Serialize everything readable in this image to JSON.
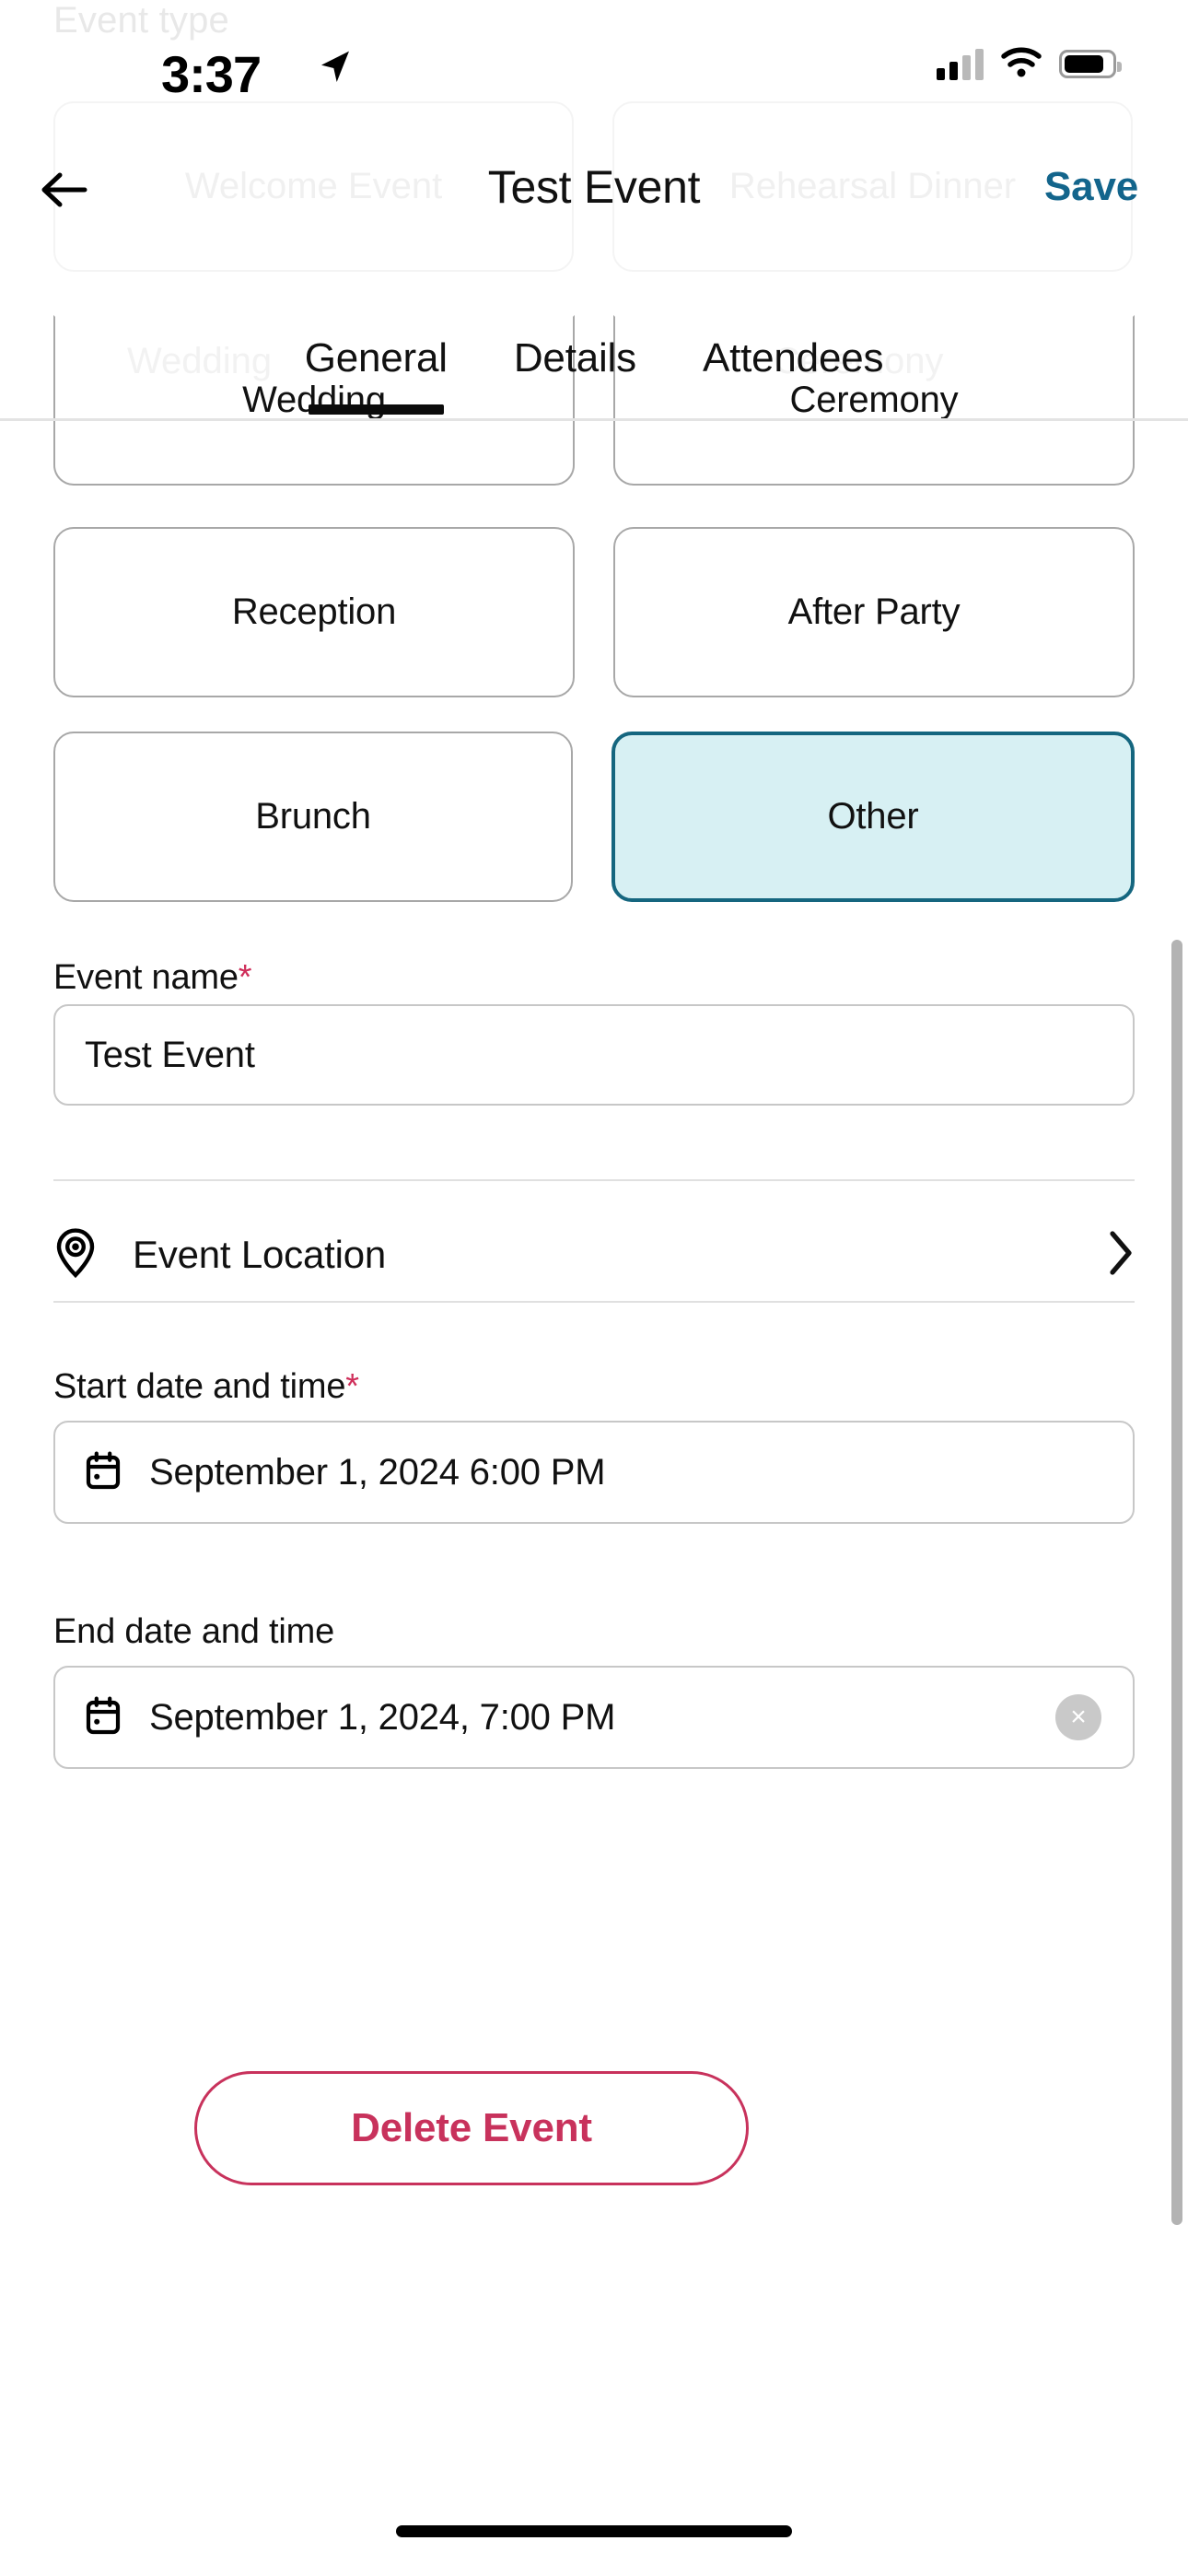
{
  "status_bar": {
    "time": "3:37",
    "location_icon": "location-arrow-icon",
    "signal_icon": "cellular-signal-icon",
    "wifi_icon": "wifi-icon",
    "battery_icon": "battery-icon"
  },
  "nav": {
    "back_icon": "arrow-left-icon",
    "title": "Test Event",
    "save_label": "Save",
    "save_color": "#13658c"
  },
  "tabs": [
    {
      "label": "General",
      "active": true
    },
    {
      "label": "Details",
      "active": false
    },
    {
      "label": "Attendees",
      "active": false
    }
  ],
  "ghost": {
    "section_label": "Event type",
    "chips": [
      "Welcome Event",
      "Rehearsal Dinner"
    ],
    "chips_row2": [
      "Wedding",
      "Ceremony"
    ]
  },
  "event_type": {
    "rows": [
      {
        "chips": [
          {
            "label": "Wedding",
            "selected": false
          },
          {
            "label": "Ceremony",
            "selected": false
          }
        ]
      },
      {
        "chips": [
          {
            "label": "Reception",
            "selected": false
          },
          {
            "label": "After Party",
            "selected": false
          }
        ]
      },
      {
        "chips": [
          {
            "label": "Brunch",
            "selected": false
          },
          {
            "label": "Other",
            "selected": true
          }
        ]
      }
    ],
    "selected_bg": "#d7f0f3",
    "selected_border": "#15667f"
  },
  "event_name": {
    "label": "Event name",
    "required_marker": "*",
    "value": "Test Event",
    "placeholder": "Event name"
  },
  "event_location": {
    "icon": "map-pin-icon",
    "label": "Event Location",
    "chevron_icon": "chevron-right-icon"
  },
  "start_date": {
    "label": "Start date and time",
    "required_marker": "*",
    "icon": "calendar-icon",
    "value": "September 1, 2024 6:00 PM"
  },
  "end_date": {
    "label": "End date and time",
    "icon": "calendar-icon",
    "value": "September 1, 2024, 7:00 PM",
    "clear_icon": "close-circle-icon",
    "clear_glyph": "×"
  },
  "delete": {
    "label": "Delete Event",
    "color": "#c8325c"
  },
  "required_color": "#cf2e5a"
}
